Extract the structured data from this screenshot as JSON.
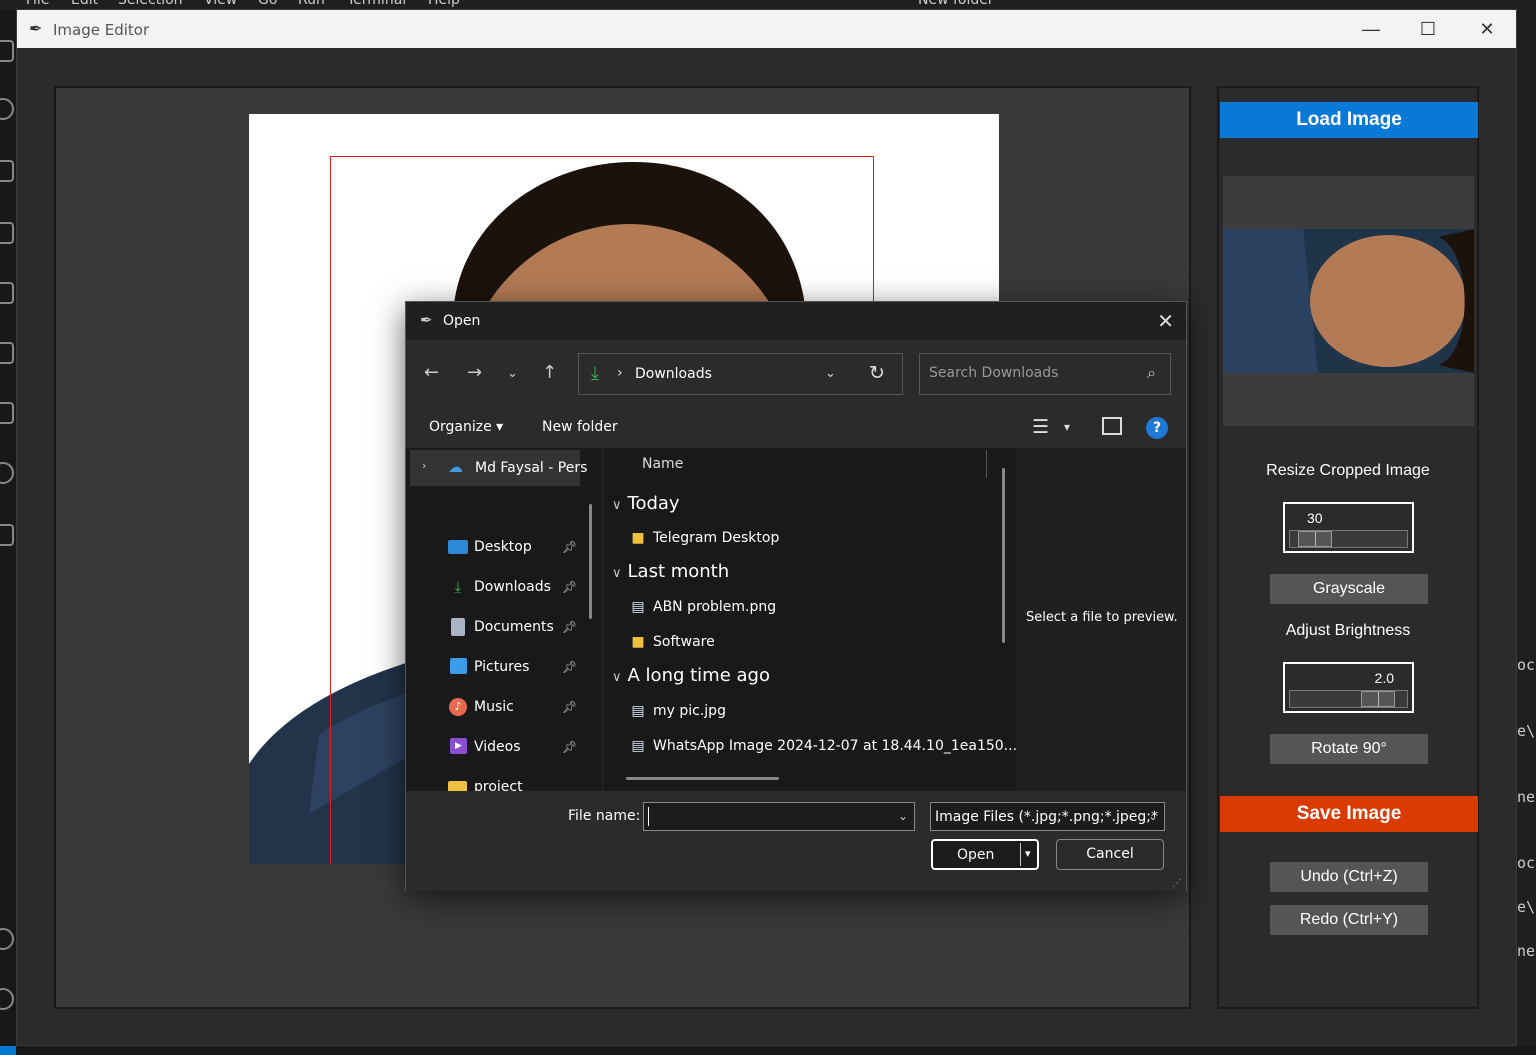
{
  "vscode": {
    "menu": [
      "File",
      "Edit",
      "Selection",
      "View",
      "Go",
      "Run",
      "Terminal",
      "Help"
    ],
    "command_center": "New folder",
    "right_fragments": [
      "oca",
      "e\\I",
      "ne\\",
      "oca",
      "e\\I",
      "ne\\"
    ]
  },
  "app": {
    "title": "Image Editor",
    "load_button": "Load Image",
    "resize_label": "Resize Cropped Image",
    "resize_value": "30",
    "resize_fraction": 0.1,
    "grayscale_button": "Grayscale",
    "brightness_label": "Adjust Brightness",
    "brightness_value": "2.0",
    "brightness_fraction": 0.85,
    "rotate_button": "Rotate 90°",
    "save_button": "Save Image",
    "undo_button": "Undo (Ctrl+Z)",
    "redo_button": "Redo (Ctrl+Y)",
    "colors": {
      "load": "#0a78d7",
      "save": "#da3b01",
      "crop": "#e31b1b"
    }
  },
  "dialog": {
    "title": "Open",
    "location": "Downloads",
    "search_placeholder": "Search Downloads",
    "organize": "Organize",
    "new_folder": "New folder",
    "nav": {
      "top": "Md Faysal - Pers",
      "items": [
        {
          "label": "Desktop",
          "icon": "desktop-icon"
        },
        {
          "label": "Downloads",
          "icon": "download-icon"
        },
        {
          "label": "Documents",
          "icon": "documents-icon"
        },
        {
          "label": "Pictures",
          "icon": "pictures-icon"
        },
        {
          "label": "Music",
          "icon": "music-icon"
        },
        {
          "label": "Videos",
          "icon": "videos-icon"
        },
        {
          "label": "project",
          "icon": "folder-icon"
        }
      ]
    },
    "column_name": "Name",
    "groups": [
      {
        "label": "Today",
        "files": [
          {
            "name": "Telegram Desktop",
            "type": "folder"
          }
        ]
      },
      {
        "label": "Last month",
        "files": [
          {
            "name": "ABN problem.png",
            "type": "image"
          },
          {
            "name": "Software",
            "type": "folder"
          }
        ]
      },
      {
        "label": "A long time ago",
        "files": [
          {
            "name": "my pic.jpg",
            "type": "image"
          },
          {
            "name": "WhatsApp Image 2024-12-07 at 18.44.10_1ea150...",
            "type": "image"
          }
        ]
      }
    ],
    "preview_text": "Select a file to preview.",
    "file_name_label": "File name:",
    "file_name_value": "",
    "filter": "Image Files (*.jpg;*.png;*.jpeg;*",
    "open_button": "Open",
    "cancel_button": "Cancel"
  }
}
